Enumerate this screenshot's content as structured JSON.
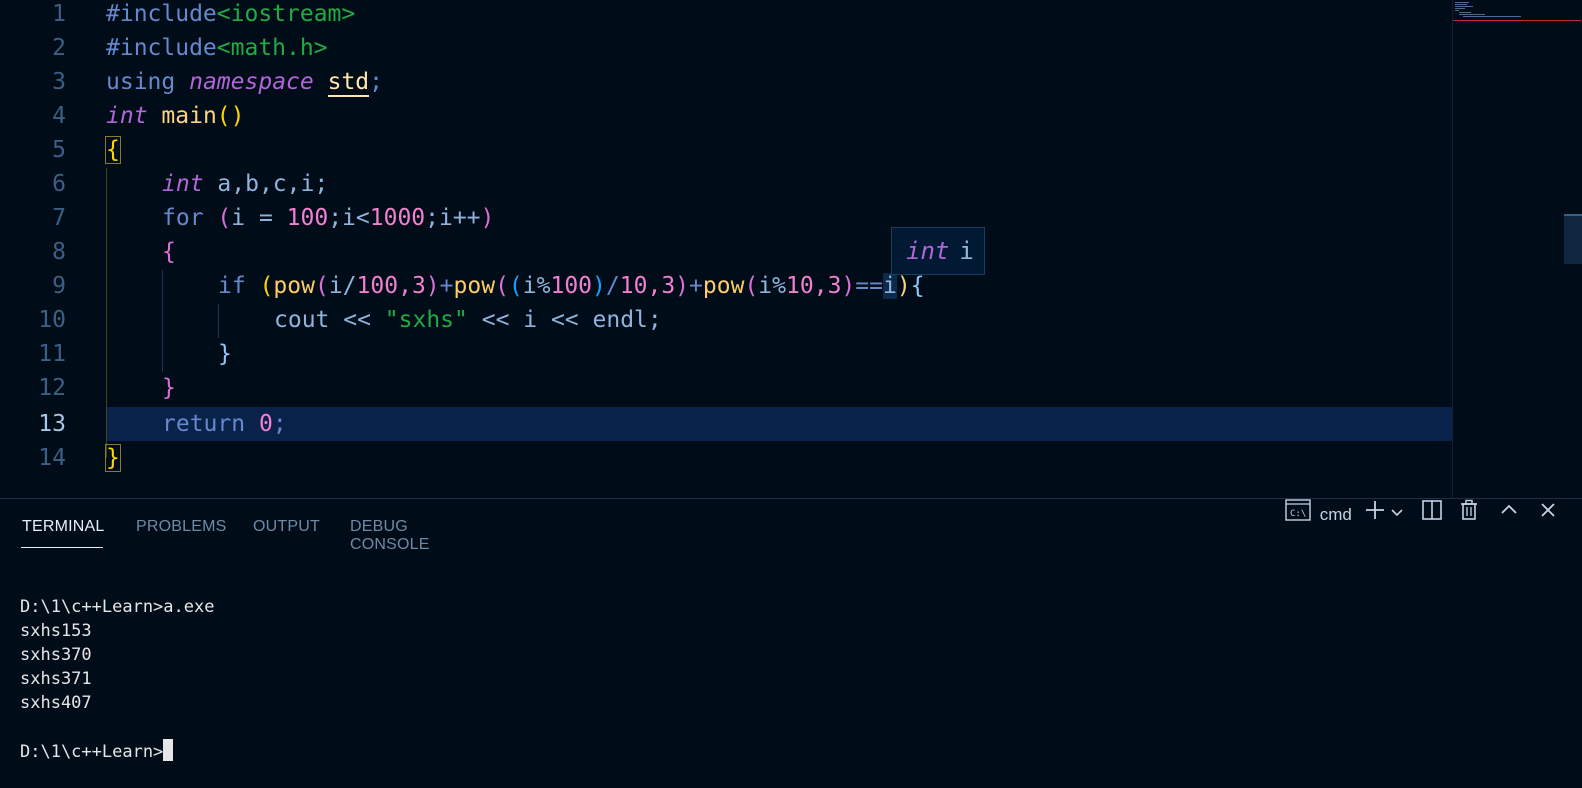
{
  "editor": {
    "line_numbers": [
      "1",
      "2",
      "3",
      "4",
      "5",
      "6",
      "7",
      "8",
      "9",
      "10",
      "11",
      "12",
      "13",
      "14"
    ],
    "active_line": "13",
    "lines": {
      "l1": {
        "pre": "#include",
        "inc": "<iostream>"
      },
      "l2": {
        "pre": "#include",
        "inc": "<math.h>"
      },
      "l3": {
        "kw": "using",
        "ty": "namespace",
        "id": "std",
        "end": ";"
      },
      "l4": {
        "ty": "int",
        "fn": "main",
        "open": "(",
        "close": ")"
      },
      "l5": {
        "brace": "{"
      },
      "l6": {
        "ty": "int",
        "rest": "a,b,c,i;"
      },
      "l7": {
        "kw": "for",
        "p_open": "(",
        "a": "i = ",
        "n1": "100",
        "b": ";i<",
        "n2": "1000",
        "c": ";i++",
        "p_close": ")"
      },
      "l8": {
        "brace": "{"
      },
      "l9": {
        "kw": "if",
        "p_open": "(",
        "fn": "pow",
        "rest_a": "i/",
        "n100": "100",
        "comma": ",",
        "n3": "3",
        "plus": "+",
        "n10": "10",
        "eq": "==",
        "i": "i",
        "close": ")",
        "brace": "{"
      },
      "l10": {
        "text": "cout << ",
        "str": "\"sxhs\"",
        "rest": " << i << endl;"
      },
      "l11": {
        "brace": "}"
      },
      "l12": {
        "brace": "}"
      },
      "l13": {
        "kw": "return",
        "num": "0",
        "end": ";"
      },
      "l14": {
        "brace": "}"
      }
    },
    "hover": {
      "type": "int",
      "name": "i"
    }
  },
  "panel": {
    "tabs": [
      "TERMINAL",
      "PROBLEMS",
      "OUTPUT",
      "DEBUG CONSOLE"
    ],
    "shell": "cmd",
    "terminal_lines": [
      "D:\\1\\c++Learn>a.exe",
      "sxhs153",
      "sxhs370",
      "sxhs371",
      "sxhs407",
      "",
      "D:\\1\\c++Learn>"
    ]
  },
  "colors": {
    "background": "#000c18",
    "current_line": "#08224a",
    "keyword": "#6688cc",
    "type": "#b166d8",
    "function": "#ffd37c",
    "number": "#f280d0",
    "string": "#22aa44"
  },
  "icons": [
    "terminal-icon",
    "plus-icon",
    "chevron-down-icon",
    "split-icon",
    "trash-icon",
    "chevron-up-icon",
    "close-icon"
  ]
}
